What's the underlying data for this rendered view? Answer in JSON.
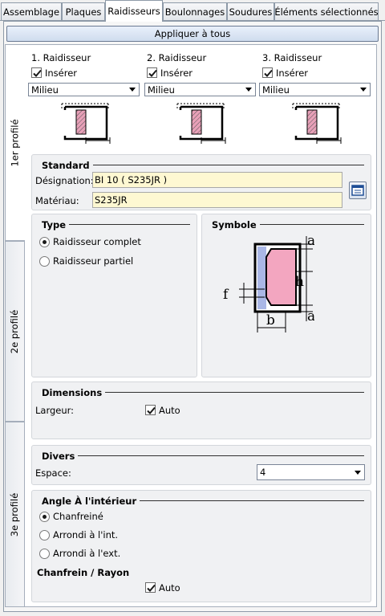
{
  "tabs": [
    "Assemblage",
    "Plaques",
    "Raidisseurs",
    "Boulonnages",
    "Soudures",
    "Éléments sélectionnés"
  ],
  "apply_button": "Appliquer à tous",
  "side_tabs": [
    "1er profilé",
    "2e profilé",
    "3e profilé"
  ],
  "stiffeners": [
    {
      "title": "1. Raidisseur",
      "insert_label": "Insérer",
      "insert_checked": true,
      "position": "Milieu"
    },
    {
      "title": "2. Raidisseur",
      "insert_label": "Insérer",
      "insert_checked": true,
      "position": "Milieu"
    },
    {
      "title": "3. Raidisseur",
      "insert_label": "Insérer",
      "insert_checked": true,
      "position": "Milieu"
    }
  ],
  "standard": {
    "title": "Standard",
    "designation_label": "Désignation:",
    "designation_value": "BI 10  ( S235JR )",
    "material_label": "Matériau:",
    "material_value": "S235JR",
    "library_icon": "catalog-icon"
  },
  "type": {
    "title": "Type",
    "options": [
      "Raidisseur complet",
      "Raidisseur partiel"
    ],
    "selected": 0
  },
  "symbol": {
    "title": "Symbole",
    "labels": {
      "a_top": "a",
      "h": "h",
      "f": "f",
      "a_bottom": "a",
      "b": "b"
    }
  },
  "dimensions": {
    "title": "Dimensions",
    "width_label": "Largeur:",
    "auto_label": "Auto",
    "auto_checked": true
  },
  "divers": {
    "title": "Divers",
    "spacing_label": "Espace:",
    "spacing_value": "4"
  },
  "angle": {
    "title": "Angle À l'intérieur",
    "options": [
      "Chanfreiné",
      "Arrondi à l'int.",
      "Arrondi à l'ext."
    ],
    "selected": 0,
    "chamfer_title": "Chanfrein / Rayon",
    "auto_label": "Auto",
    "auto_checked": true
  },
  "colors": {
    "field_bg": "#fef8d2",
    "hatch": "#e8a0b8",
    "accent": "#1f4e96"
  }
}
